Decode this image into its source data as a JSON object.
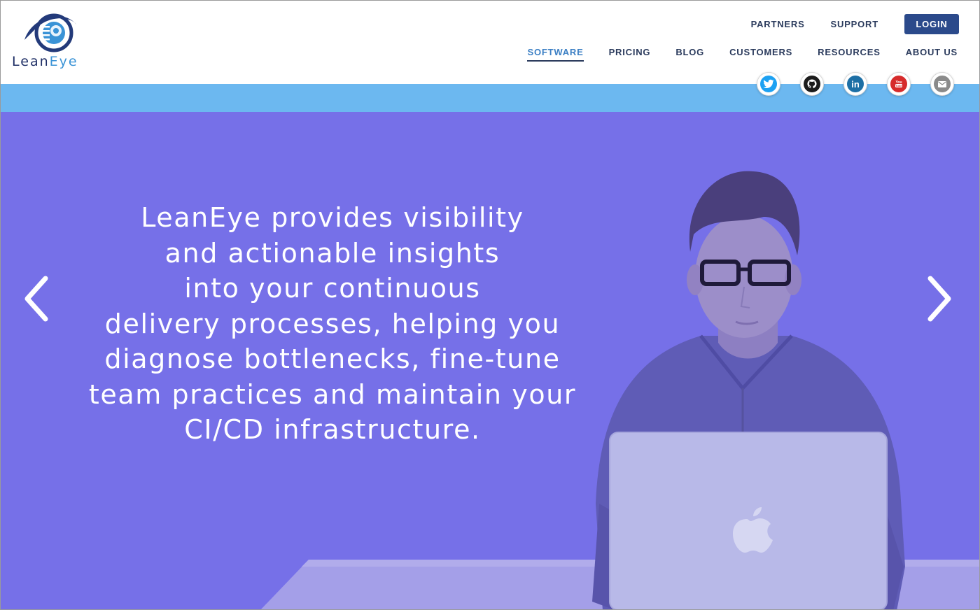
{
  "brand": {
    "name_part1": "Lean",
    "name_part2": "Eye"
  },
  "top_nav": {
    "partners": "PARTNERS",
    "support": "SUPPORT",
    "login": "LOGIN"
  },
  "main_nav": [
    {
      "label": "SOFTWARE",
      "active": true
    },
    {
      "label": "PRICING"
    },
    {
      "label": "BLOG"
    },
    {
      "label": "CUSTOMERS"
    },
    {
      "label": "RESOURCES"
    },
    {
      "label": "ABOUT US"
    }
  ],
  "socials": [
    {
      "name": "twitter-icon",
      "color": "#1da1f2"
    },
    {
      "name": "github-icon",
      "color": "#1b1b1b"
    },
    {
      "name": "linkedin-icon",
      "color": "#1d6fa5"
    },
    {
      "name": "youtube-icon",
      "color": "#d62b2b",
      "label": "You\nTube"
    },
    {
      "name": "email-icon",
      "color": "#8a8a8a"
    }
  ],
  "hero": {
    "lines": [
      "LeanEye provides visibility",
      "and actionable insights",
      "into your continuous",
      "delivery processes, helping you",
      "diagnose bottlenecks, fine-tune",
      "team practices and maintain your",
      "CI/CD infrastructure."
    ]
  },
  "colors": {
    "hero_overlay": "#7670e8",
    "band": "#6cb8f0",
    "nav_text": "#2a3a5c",
    "active_nav": "#3b7fc4",
    "login_bg": "#2b4a8b"
  }
}
